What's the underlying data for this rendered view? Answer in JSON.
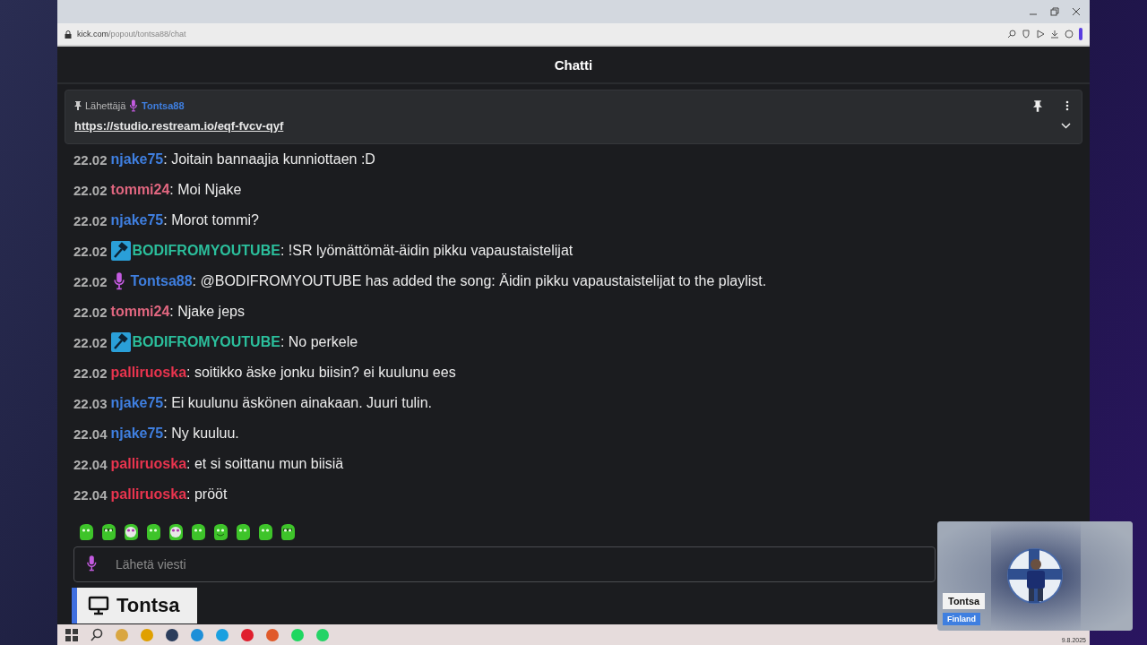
{
  "browser": {
    "url_host": "kick.com",
    "url_path": "/popout/tontsa88/chat"
  },
  "chat": {
    "title": "Chatti",
    "pinned": {
      "label": "Lähettäjä",
      "user": "Tontsa88",
      "color": "#3f7fe0",
      "link": "https://studio.restream.io/eqf-fvcv-qyf"
    },
    "messages": [
      {
        "kind": "user",
        "time": "22.02",
        "user": "njake75",
        "color": "#3f7fe0",
        "text": ": Joitain bannaajia kunniottaen :D"
      },
      {
        "kind": "user",
        "time": "22.02",
        "user": "tommi24",
        "color": "#e0667f",
        "text": ": Moi Njake"
      },
      {
        "kind": "user",
        "time": "22.02",
        "user": "njake75",
        "color": "#3f7fe0",
        "text": ": Morot tommi?"
      },
      {
        "kind": "moderator",
        "time": "22.02",
        "user": "BODIFROMYOUTUBE",
        "color": "#2bbf9c",
        "text": ": !SR lyömättömät-äidin pikku vapaustaistelijat"
      },
      {
        "kind": "broadcaster",
        "time": "22.02",
        "user": "Tontsa88",
        "color": "#3f7fe0",
        "text": ": @BODIFROMYOUTUBE has added the song: Äidin pikku vapaustaistelijat to the playlist."
      },
      {
        "kind": "user",
        "time": "22.02",
        "user": "tommi24",
        "color": "#e0667f",
        "text": ": Njake jeps"
      },
      {
        "kind": "moderator",
        "time": "22.02",
        "user": "BODIFROMYOUTUBE",
        "color": "#2bbf9c",
        "text": ": No perkele"
      },
      {
        "kind": "user",
        "time": "22.02",
        "user": "palliruoska",
        "color": "#e8344e",
        "text": ": soitikko äske jonku biisin? ei kuulunu ees"
      },
      {
        "kind": "user",
        "time": "22.03",
        "user": "njake75",
        "color": "#3f7fe0",
        "text": ": Ei kuulunu äskönen ainakaan. Juuri tulin."
      },
      {
        "kind": "user",
        "time": "22.04",
        "user": "njake75",
        "color": "#3f7fe0",
        "text": ": Ny kuuluu."
      },
      {
        "kind": "user",
        "time": "22.04",
        "user": "palliruoska",
        "color": "#e8344e",
        "text": ": et si soittanu mun biisiä"
      },
      {
        "kind": "user",
        "time": "22.04",
        "user": "palliruoska",
        "color": "#e8344e",
        "text": ": prööt"
      }
    ],
    "input": {
      "placeholder": "Lähetä viesti"
    }
  },
  "overlay": {
    "name": "Tontsa"
  },
  "webcam": {
    "name": "Tontsa",
    "country": "Finland"
  },
  "taskbar": {
    "date": "9.8.2025"
  }
}
